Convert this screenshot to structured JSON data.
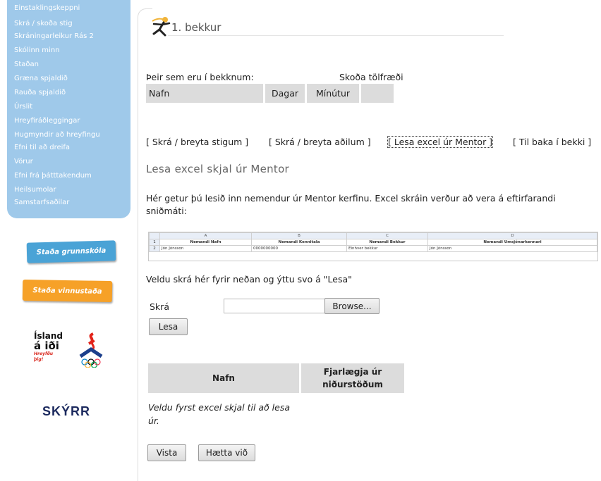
{
  "sidebar": {
    "items": [
      "Einstaklingskeppni",
      "Skrá / skoða stig",
      "Skráningarleikur Rás 2",
      "Skólinn minn",
      "Staðan",
      "Græna spjaldið",
      "Rauða spjaldið",
      "Úrslit",
      "Hreyfiráðleggingar",
      "Hugmyndir að hreyfingu",
      "Efni til að dreifa",
      "Vörur",
      "Efni frá þátttakendum",
      "Heilsumolar",
      "Samstarfsaðilar"
    ],
    "badge_grunnskola": "Staða grunnskóla",
    "badge_vinnustada": "Staða vinnustaða",
    "logo_island": [
      "Ísland",
      "á iði",
      "Hreyfðu þig!"
    ],
    "logo_skyrr": "SKÝRR"
  },
  "header": {
    "title": "1. bekkur"
  },
  "class": {
    "members_label": "Þeir sem eru í bekknum:",
    "stats_link": "Skoða tölfræði",
    "columns": [
      "Nafn",
      "Dagar",
      "Mínútur",
      ""
    ]
  },
  "links": [
    "[ Skrá / breyta stigum ]",
    "[ Skrá / breyta aðilum ]",
    "[ Lesa excel úr Mentor ]",
    "[ Til baka í bekki ]"
  ],
  "section": {
    "heading": "Lesa excel skjal úr Mentor",
    "description": "Hér getur þú lesið inn nemendur úr Mentor kerfinu. Excel skráin verður að vera á eftirfarandi sniðmáti:"
  },
  "excel_example": {
    "col_letters": [
      "",
      "A",
      "B",
      "C",
      "D"
    ],
    "row1": [
      "1",
      "Nemandi Nafn",
      "Nemandi Kennitala",
      "Nemandi Bekkur",
      "Nemandi Umsjónarkennari"
    ],
    "row2": [
      "2",
      "Jón Jónsson",
      "0000000000",
      "Einhver bekkur",
      "Jón Jónsson"
    ]
  },
  "upload": {
    "instruction": "Veldu skrá hér fyrir neðan og ýttu svo á \"Lesa\"",
    "file_label": "Skrá",
    "browse_label": "Browse...",
    "read_label": "Lesa"
  },
  "results": {
    "col_name": "Nafn",
    "col_remove_1": "Fjarlægja úr",
    "col_remove_2": "niðurstöðum",
    "empty_message": "Veldu fyrst excel skjal til að lesa úr."
  },
  "actions": {
    "save_label": "Vista",
    "cancel_label": "Hætta við"
  },
  "colors": {
    "nav_bg": "#9fc9ea",
    "header_gray": "#dcdcdc",
    "badge_blue": "#4aa3d6",
    "badge_orange": "#f6a128"
  }
}
